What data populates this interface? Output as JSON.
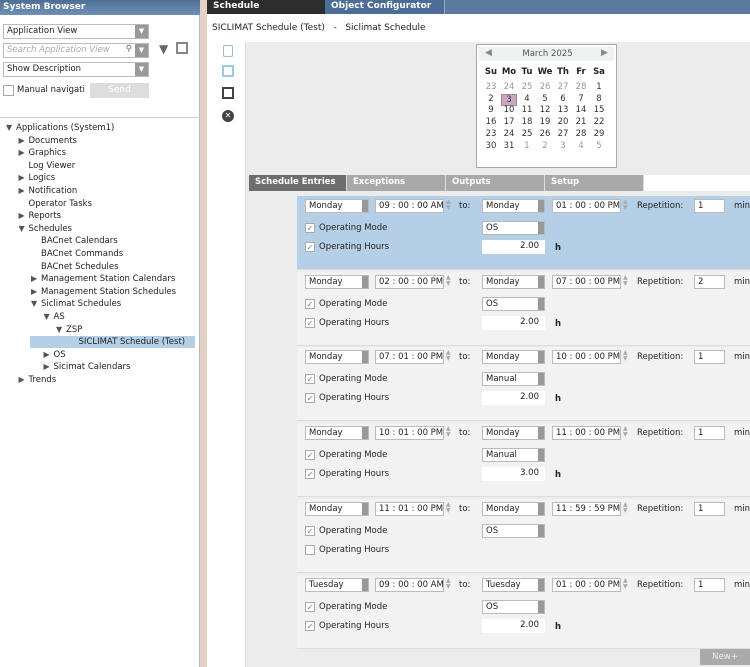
{
  "left": {
    "title": "System Browser",
    "view_select": "Application View",
    "search_placeholder": "Search Application View",
    "desc_select": "Show Description",
    "manual_nav": "Manual navigation",
    "send": "Send",
    "tree": [
      {
        "label": "Applications (System1)",
        "level": 0,
        "state": "open"
      },
      {
        "label": "Documents",
        "level": 1,
        "state": "closed"
      },
      {
        "label": "Graphics",
        "level": 1,
        "state": "closed"
      },
      {
        "label": "Log Viewer",
        "level": 1,
        "state": "leaf"
      },
      {
        "label": "Logics",
        "level": 1,
        "state": "closed"
      },
      {
        "label": "Notification",
        "level": 1,
        "state": "closed"
      },
      {
        "label": "Operator Tasks",
        "level": 1,
        "state": "leaf"
      },
      {
        "label": "Reports",
        "level": 1,
        "state": "closed"
      },
      {
        "label": "Schedules",
        "level": 1,
        "state": "open"
      },
      {
        "label": "BACnet Calendars",
        "level": 2,
        "state": "leaf"
      },
      {
        "label": "BACnet Commands",
        "level": 2,
        "state": "leaf"
      },
      {
        "label": "BACnet Schedules",
        "level": 2,
        "state": "leaf"
      },
      {
        "label": "Management Station Calendars",
        "level": 2,
        "state": "closed"
      },
      {
        "label": "Management Station Schedules",
        "level": 2,
        "state": "closed"
      },
      {
        "label": "Siclimat Schedules",
        "level": 2,
        "state": "open"
      },
      {
        "label": "AS",
        "level": 3,
        "state": "open"
      },
      {
        "label": "ZSP",
        "level": 4,
        "state": "open"
      },
      {
        "label": "SICLIMAT Schedule (Test)",
        "level": 5,
        "state": "leaf",
        "selected": true
      },
      {
        "label": "OS",
        "level": 3,
        "state": "closed"
      },
      {
        "label": "Sicimat Calendars",
        "level": 3,
        "state": "closed"
      },
      {
        "label": "Trends",
        "level": 1,
        "state": "closed"
      }
    ]
  },
  "tabs": {
    "schedule": "Schedule",
    "object_configurator": "Object Configurator"
  },
  "header": {
    "name": "SICLIMAT Schedule (Test)",
    "sep": "-",
    "type": "Siclimat Schedule"
  },
  "calendar": {
    "month": "March 2025",
    "weekdays": [
      "Su",
      "Mo",
      "Tu",
      "We",
      "Th",
      "Fr",
      "Sa"
    ],
    "days": [
      [
        "23",
        "24",
        "25",
        "26",
        "27",
        "28",
        "1"
      ],
      [
        "2",
        "3",
        "4",
        "5",
        "6",
        "7",
        "8"
      ],
      [
        "9",
        "10",
        "11",
        "12",
        "13",
        "14",
        "15"
      ],
      [
        "16",
        "17",
        "18",
        "19",
        "20",
        "21",
        "22"
      ],
      [
        "23",
        "24",
        "25",
        "26",
        "27",
        "28",
        "29"
      ],
      [
        "30",
        "31",
        "1",
        "2",
        "3",
        "4",
        "5"
      ]
    ],
    "selected": "3"
  },
  "subtabs": [
    "Schedule Entries",
    "Exceptions",
    "Outputs",
    "Setup"
  ],
  "labels": {
    "to": "to:",
    "repetition": "Repetition:",
    "min": "min.",
    "mode": "Operating Mode",
    "hours": "Operating Hours",
    "h": "h",
    "new": "New+"
  },
  "entries": [
    {
      "day_from": "Monday",
      "time_from": "09 : 00 : 00  AM",
      "day_to": "Monday",
      "time_to": "01 : 00 : 00  PM",
      "repetition": "1",
      "mode_checked": true,
      "mode": "OS",
      "hours_checked": true,
      "hours": "2.00",
      "selected": true
    },
    {
      "day_from": "Monday",
      "time_from": "02 : 00 : 00  PM",
      "day_to": "Monday",
      "time_to": "07 : 00 : 00  PM",
      "repetition": "2",
      "mode_checked": true,
      "mode": "OS",
      "hours_checked": true,
      "hours": "2.00"
    },
    {
      "day_from": "Monday",
      "time_from": "07 : 01 : 00  PM",
      "day_to": "Monday",
      "time_to": "10 : 00 : 00  PM",
      "repetition": "1",
      "mode_checked": true,
      "mode": "Manual",
      "hours_checked": true,
      "hours": "2.00"
    },
    {
      "day_from": "Monday",
      "time_from": "10 : 01 : 00  PM",
      "day_to": "Monday",
      "time_to": "11 : 00 : 00  PM",
      "repetition": "1",
      "mode_checked": true,
      "mode": "Manual",
      "hours_checked": true,
      "hours": "3.00"
    },
    {
      "day_from": "Monday",
      "time_from": "11 : 01 : 00  PM",
      "day_to": "Monday",
      "time_to": "11 : 59 : 59  PM",
      "repetition": "1",
      "mode_checked": true,
      "mode": "OS",
      "hours_checked": false,
      "hours": null
    },
    {
      "day_from": "Tuesday",
      "time_from": "09 : 00 : 00  AM",
      "day_to": "Tuesday",
      "time_to": "01 : 00 : 00  PM",
      "repetition": "1",
      "mode_checked": true,
      "mode": "OS",
      "hours_checked": true,
      "hours": "2.00"
    }
  ],
  "colors": {
    "selected_entry": "#b5cfe6",
    "tab_active": "#6e6e6e",
    "header_blue": "#5a7aa0",
    "calendar_selected": "#c8a9c3"
  }
}
